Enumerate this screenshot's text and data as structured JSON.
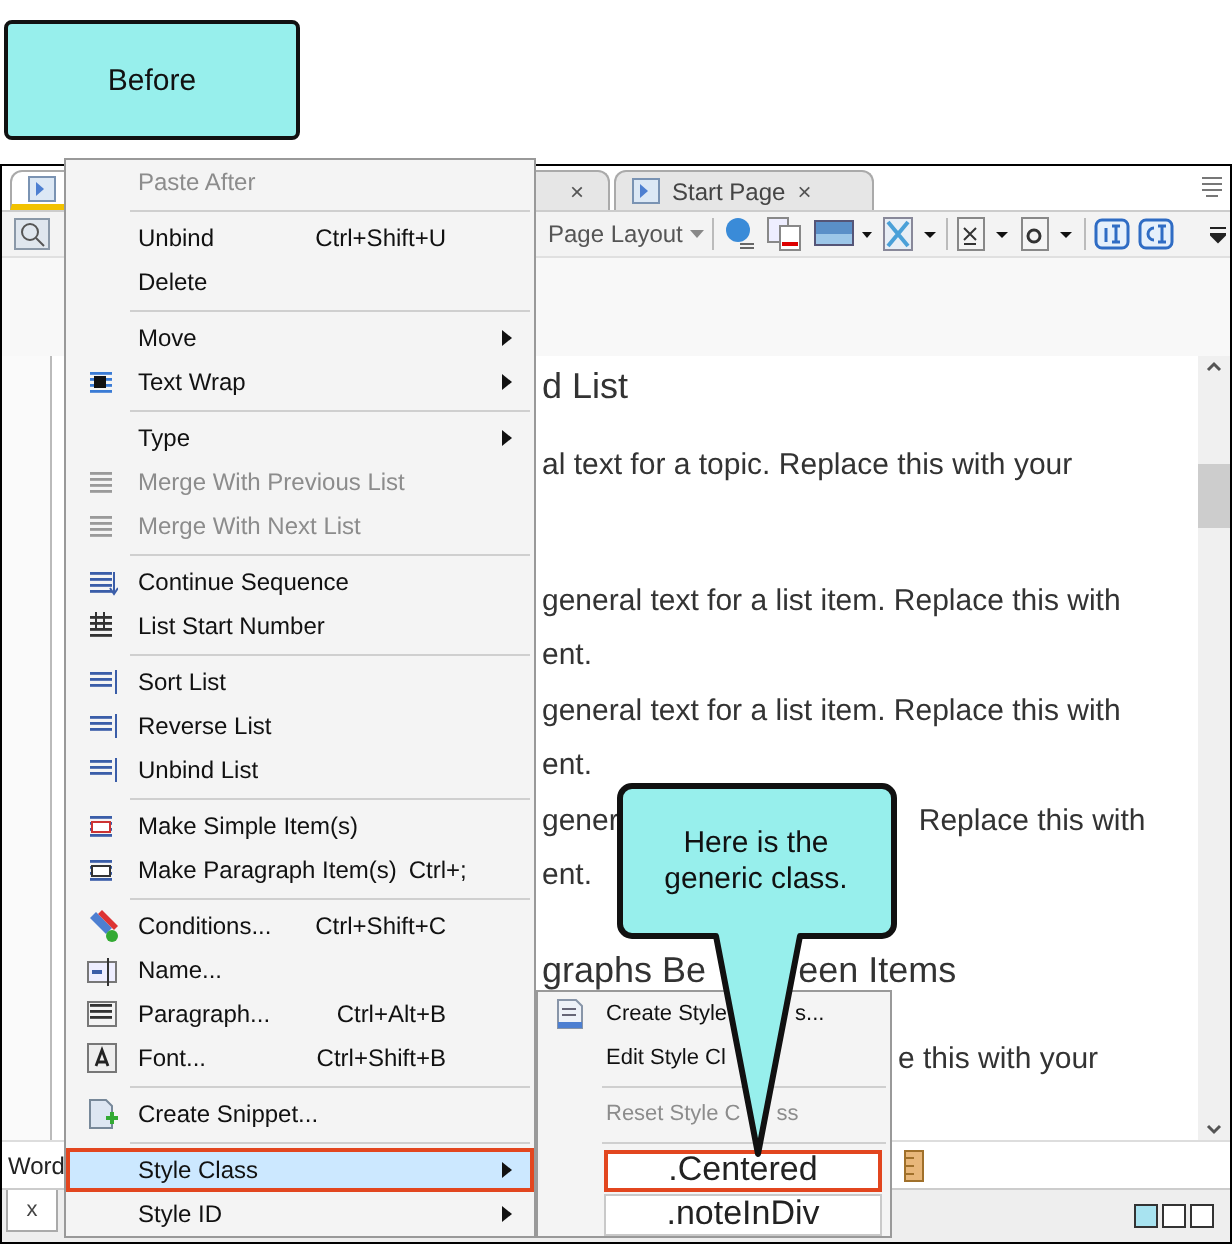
{
  "label_box": {
    "text": "Before"
  },
  "tabs": [
    {
      "selected": true
    },
    {
      "close": "×",
      "selected": false
    },
    {
      "label": "Start Page",
      "close": "×",
      "selected": false
    }
  ],
  "toolbar": {
    "dropdown": "Page Layout"
  },
  "editor": {
    "lines": [
      {
        "kind": "heading",
        "segments": [
          "d List"
        ]
      },
      {
        "kind": "text",
        "segments": [
          "al text for a topic. Replace this with your"
        ]
      },
      {
        "kind": "item",
        "segments": [
          "general text for a list item. Replace this with"
        ]
      },
      {
        "kind": "cont",
        "segments": [
          "ent."
        ]
      },
      {
        "kind": "item",
        "segments": [
          "general text for a list item. Replace this with"
        ]
      },
      {
        "kind": "cont",
        "segments": [
          "ent."
        ]
      },
      {
        "kind": "item",
        "segments": [
          "gener",
          "Replace this with"
        ]
      },
      {
        "kind": "cont",
        "segments": [
          "ent."
        ]
      },
      {
        "kind": "heading",
        "segments": [
          "graphs Be",
          "een Items"
        ]
      },
      {
        "kind": "text",
        "segments": [
          "e this with your"
        ]
      }
    ]
  },
  "status_bar": {
    "text": "Word"
  },
  "bottom_tab": {
    "close": "x"
  },
  "context_menu": {
    "items": [
      {
        "kind": "item",
        "label": "Paste After",
        "disabled": true,
        "selected": false
      },
      {
        "kind": "separator"
      },
      {
        "kind": "item",
        "label": "Unbind",
        "shortcut": "Ctrl+Shift+U",
        "disabled": false,
        "selected": false
      },
      {
        "kind": "item",
        "label": "Delete",
        "disabled": false,
        "selected": false
      },
      {
        "kind": "separator"
      },
      {
        "kind": "item",
        "label": "Move",
        "submenu": true,
        "disabled": false,
        "selected": false
      },
      {
        "kind": "item",
        "label": "Text Wrap",
        "icon": true,
        "submenu": true,
        "disabled": false,
        "selected": false
      },
      {
        "kind": "separator"
      },
      {
        "kind": "item",
        "label": "Type",
        "submenu": true,
        "disabled": false,
        "selected": false
      },
      {
        "kind": "item",
        "label": "Merge With Previous List",
        "icon": true,
        "disabled": true,
        "selected": false
      },
      {
        "kind": "item",
        "label": "Merge With Next List",
        "icon": true,
        "disabled": true,
        "selected": false
      },
      {
        "kind": "separator"
      },
      {
        "kind": "item",
        "label": "Continue Sequence",
        "icon": true,
        "disabled": false,
        "selected": false
      },
      {
        "kind": "item",
        "label": "List Start Number",
        "icon": true,
        "disabled": false,
        "selected": false
      },
      {
        "kind": "separator"
      },
      {
        "kind": "item",
        "label": "Sort List",
        "icon": true,
        "disabled": false,
        "selected": false
      },
      {
        "kind": "item",
        "label": "Reverse List",
        "icon": true,
        "disabled": false,
        "selected": false
      },
      {
        "kind": "item",
        "label": "Unbind List",
        "icon": true,
        "disabled": false,
        "selected": false
      },
      {
        "kind": "separator"
      },
      {
        "kind": "item",
        "label": "Make Simple Item(s)",
        "icon": true,
        "disabled": false,
        "selected": false
      },
      {
        "kind": "item",
        "label": "Make Paragraph Item(s)",
        "shortcut": "Ctrl+;",
        "icon": true,
        "disabled": false,
        "selected": false
      },
      {
        "kind": "separator"
      },
      {
        "kind": "item",
        "label": "Conditions...",
        "shortcut": "Ctrl+Shift+C",
        "icon": true,
        "disabled": false,
        "selected": false
      },
      {
        "kind": "item",
        "label": "Name...",
        "icon": true,
        "disabled": false,
        "selected": false
      },
      {
        "kind": "item",
        "label": "Paragraph...",
        "shortcut": "Ctrl+Alt+B",
        "icon": true,
        "disabled": false,
        "selected": false
      },
      {
        "kind": "item",
        "label": "Font...",
        "shortcut": "Ctrl+Shift+B",
        "icon": true,
        "disabled": false,
        "selected": false
      },
      {
        "kind": "separator"
      },
      {
        "kind": "item",
        "label": "Create Snippet...",
        "icon": true,
        "disabled": false,
        "selected": false
      },
      {
        "kind": "separator"
      },
      {
        "kind": "item",
        "label": "Style Class",
        "submenu": true,
        "disabled": false,
        "selected": true
      },
      {
        "kind": "item",
        "label": "Style ID",
        "submenu": true,
        "disabled": false,
        "selected": false
      }
    ]
  },
  "submenu": {
    "items": [
      {
        "kind": "item",
        "label_parts": [
          "Create Style",
          "s..."
        ],
        "icon": true,
        "disabled": false
      },
      {
        "kind": "item",
        "label_parts": [
          "Edit Style Cl"
        ],
        "disabled": false
      },
      {
        "kind": "separator"
      },
      {
        "kind": "item",
        "label_parts": [
          "Reset Style C",
          "ss"
        ],
        "disabled": true
      },
      {
        "kind": "separator"
      },
      {
        "kind": "class",
        "label": ".Centered",
        "selected": true
      },
      {
        "kind": "class",
        "label": ".noteInDiv",
        "selected": false
      }
    ]
  },
  "callout": {
    "text": "Here is the generic class."
  }
}
